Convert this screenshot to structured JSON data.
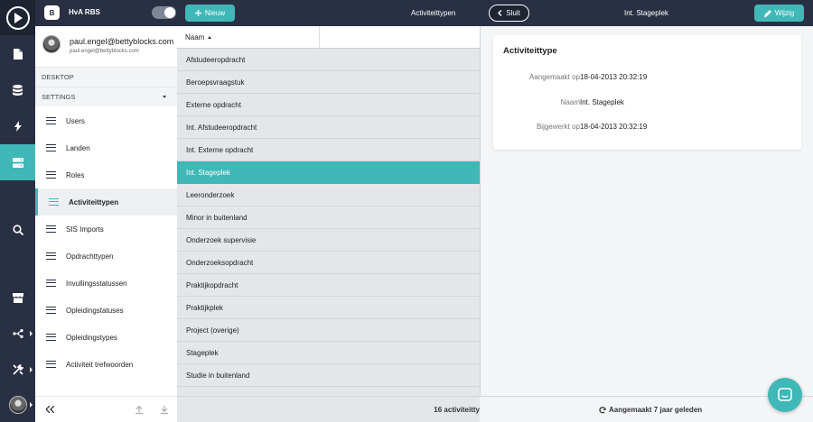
{
  "header": {
    "logo_letter": "B",
    "app_name": "HvA RBS",
    "new_button": "Nieuw",
    "list_title": "Activiteittypen"
  },
  "rail": {
    "items": [
      "play-icon",
      "file-icon",
      "database-icon",
      "lightning-icon",
      "server-icon",
      "search-icon",
      "store-icon",
      "share-icon",
      "tools-icon",
      "avatar"
    ],
    "active": "server-icon"
  },
  "user": {
    "name": "paul.engel@bettyblocks.com",
    "email": "paul.engel@bettyblocks.com"
  },
  "sidebar": {
    "section_desktop": "DESKTOP",
    "section_settings": "SETTINGS",
    "items": [
      {
        "label": "Users"
      },
      {
        "label": "Landen"
      },
      {
        "label": "Roles"
      },
      {
        "label": "Activiteittypen"
      },
      {
        "label": "SIS Imports"
      },
      {
        "label": "Opdrachttypen"
      },
      {
        "label": "Invullingsstatussen"
      },
      {
        "label": "Opleidingstatuses"
      },
      {
        "label": "Opleidingstypes"
      },
      {
        "label": "Activiteit trefwoorden"
      }
    ],
    "active_index": 3
  },
  "list": {
    "column": "Naam",
    "rows": [
      "Afstudeeropdracht",
      "Beroepsvraagstuk",
      "Externe opdracht",
      "Int. Afstudeeropdracht",
      "Int. Externe opdracht",
      "Int. Stageplek",
      "Leeronderzoek",
      "Minor in buitenland",
      "Onderzoek supervisie",
      "Onderzoeksopdracht",
      "Praktijkopdracht",
      "Praktijkplek",
      "Project (overige)",
      "Stageplek",
      "Studie in buitenland"
    ],
    "selected_index": 5,
    "count": "16 activiteitty"
  },
  "detail": {
    "close_button": "Sluit",
    "title": "Int. Stageplek",
    "edit_button": "Wijzig",
    "card_title": "Activiteittype",
    "fields": [
      {
        "label": "Aangemaakt op",
        "value": "18-04-2013 20:32:19"
      },
      {
        "label": "Naam",
        "value": "Int. Stageplek"
      },
      {
        "label": "Bijgewerkt op",
        "value": "18-04-2013 20:32:19"
      }
    ],
    "footer": "Aangemaakt 7 jaar geleden"
  },
  "colors": {
    "accent": "#3fb8b7",
    "dark": "#2a3043"
  }
}
